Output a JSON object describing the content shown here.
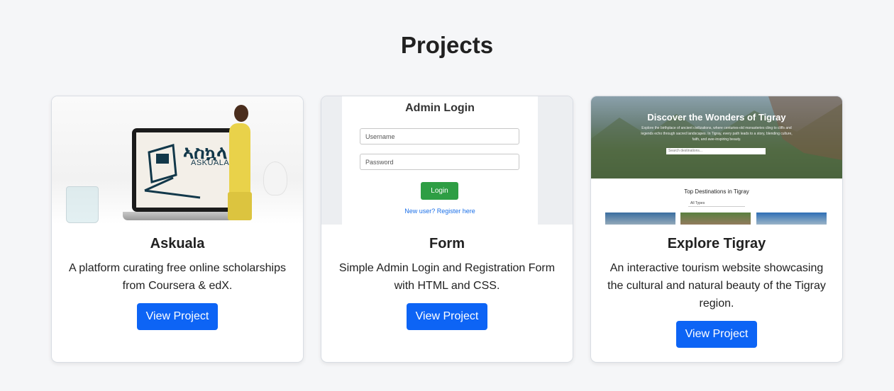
{
  "section": {
    "title": "Projects"
  },
  "projects": [
    {
      "title": "Askuala",
      "description": "A platform curating free online scholarships from Coursera & edX.",
      "button_label": "View Project",
      "thumbnail": {
        "script_text": "ኣስኳላ",
        "brand": "ASKUALA"
      }
    },
    {
      "title": "Form",
      "description": "Simple Admin Login and Registration Form with HTML and CSS.",
      "button_label": "View Project",
      "thumbnail": {
        "heading": "Admin Login",
        "username_placeholder": "Username",
        "password_placeholder": "Password",
        "login_label": "Login",
        "register_link": "New user? Register here"
      }
    },
    {
      "title": "Explore Tigray",
      "description": "An interactive tourism website showcasing the cultural and natural beauty of the Tigray region.",
      "button_label": "View Project",
      "thumbnail": {
        "hero_title": "Discover the Wonders of Tigray",
        "hero_subtitle": "Explore the birthplace of ancient civilizations, where centuries-old monasteries cling to cliffs and legends echo through sacred landscapes. In Tigray, every path leads to a story, blending culture, faith, and awe-inspiring beauty.",
        "search_placeholder": "Search destinations...",
        "section_title": "Top Destinations in Tigray",
        "filter_value": "All Types"
      }
    }
  ],
  "colors": {
    "accent": "#0d64f5",
    "login_green": "#2e9e44",
    "background": "#f5f6f8"
  }
}
